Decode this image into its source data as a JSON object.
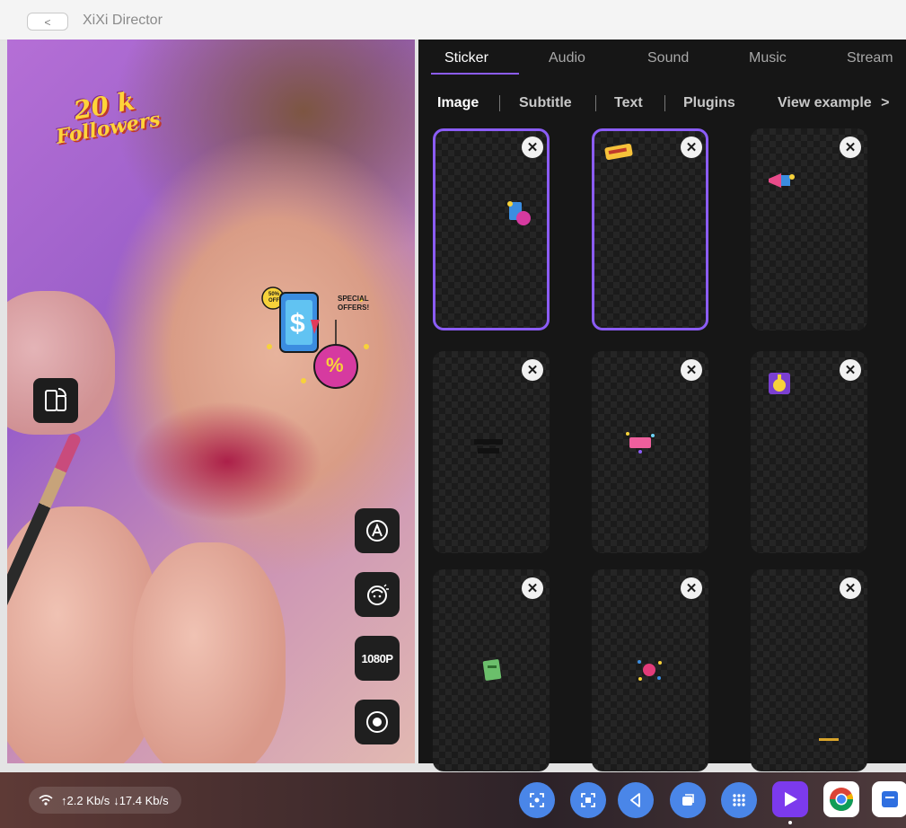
{
  "window": {
    "title": "XiXi Director",
    "back_label": "<"
  },
  "preview": {
    "sticker_followers": {
      "line1": "20 k",
      "line2": "Followers"
    },
    "sticker_offer": {
      "badge": "50% OFF",
      "line1": "SPECIAL",
      "line2": "OFFERS!",
      "currency": "$",
      "percent": "%"
    },
    "resolution": "1080P"
  },
  "tabs": [
    "Sticker",
    "Audio",
    "Sound",
    "Music",
    "Stream"
  ],
  "active_tab": "Sticker",
  "subtabs": {
    "image": "Image",
    "subtitle": "Subtitle",
    "text": "Text",
    "plugins": "Plugins",
    "view_example": "View example",
    "chevron": ">"
  },
  "stickers": {
    "close_glyph": "✕",
    "tiles": [
      {
        "id": "sticker-1",
        "selected": true,
        "icon": "sale-tablet-sticker"
      },
      {
        "id": "sticker-2",
        "selected": true,
        "icon": "followers-text-sticker"
      },
      {
        "id": "sticker-3",
        "selected": false,
        "icon": "megaphone-sticker"
      },
      {
        "id": "sticker-4",
        "selected": false,
        "icon": "dark-text-sticker"
      },
      {
        "id": "sticker-5",
        "selected": false,
        "icon": "pink-banner-sticker"
      },
      {
        "id": "sticker-6",
        "selected": false,
        "icon": "gift-sticker"
      },
      {
        "id": "sticker-7",
        "selected": false,
        "icon": "green-card-sticker"
      },
      {
        "id": "sticker-8",
        "selected": false,
        "icon": "confetti-sticker"
      },
      {
        "id": "sticker-9",
        "selected": false,
        "icon": "gold-line-sticker"
      }
    ]
  },
  "status": {
    "upload": "↑2.2 Kb/s",
    "download": "↓17.4 Kb/s"
  },
  "dock": {
    "buttons": [
      "screenshot-icon",
      "screen-record-icon",
      "back-icon",
      "recents-icon",
      "app-grid-icon"
    ],
    "apps": [
      "xixi-director-icon",
      "chrome-icon",
      "notes-icon"
    ]
  },
  "colors": {
    "accent": "#8b5cf6",
    "panel_bg": "#161616",
    "dock_blue": "#4a86e8"
  }
}
